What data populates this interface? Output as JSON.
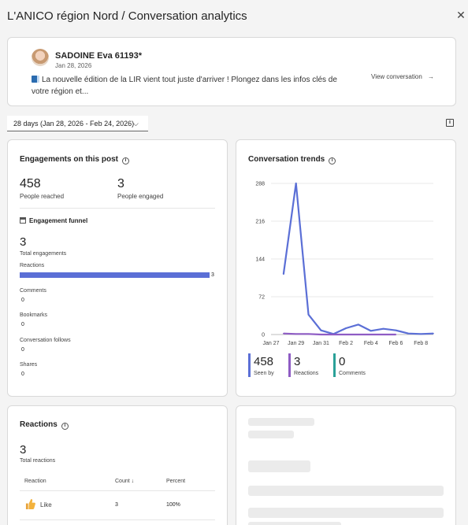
{
  "header": {
    "title": "L'ANICO région Nord / Conversation analytics",
    "close_icon": "close-icon"
  },
  "post": {
    "author": "SADOINE Eva 61193*",
    "date": "Jan 28, 2026",
    "text_line1": "La nouvelle édition de la LIR vient tout juste d'arriver ! Plongez dans les infos clés de",
    "text_line2": "votre région et...",
    "view_label": "View conversation",
    "view_arrow": "→"
  },
  "period": {
    "label": "28 days (Jan 28, 2026 - Feb 24, 2026)",
    "chevron": "⌵"
  },
  "engagement": {
    "title": "Engagements on this post",
    "reached_value": "458",
    "reached_label": "People reached",
    "engaged_value": "3",
    "engaged_label": "People engaged",
    "funnel_title": "Engagement funnel",
    "total_value": "3",
    "total_label": "Total engagements",
    "rows": [
      {
        "label": "Reactions",
        "value": "3",
        "fraction": 1.0
      },
      {
        "label": "Comments",
        "value": "0"
      },
      {
        "label": "Bookmarks",
        "value": "0"
      },
      {
        "label": "Conversation follows",
        "value": "0"
      },
      {
        "label": "Shares",
        "value": "0"
      }
    ]
  },
  "trends": {
    "title": "Conversation trends",
    "legend": [
      {
        "value": "458",
        "label": "Seen by",
        "color": "#5b6fd6"
      },
      {
        "value": "3",
        "label": "Reactions",
        "color": "#8e5cc4"
      },
      {
        "value": "0",
        "label": "Comments",
        "color": "#2aa198"
      }
    ]
  },
  "chart_data": {
    "type": "line",
    "y_ticks": [
      "0",
      "72",
      "144",
      "216",
      "288"
    ],
    "ylim": [
      0,
      288
    ],
    "x_tick_labels": [
      "Jan 27",
      "Jan 29",
      "Jan 31",
      "Feb 2",
      "Feb 4",
      "Feb 6",
      "Feb 8"
    ],
    "x_days": [
      0,
      2,
      4,
      6,
      8,
      10,
      12
    ],
    "series": [
      {
        "name": "Seen by",
        "color": "#5b6fd6",
        "x": [
          1,
          2,
          3,
          4,
          5,
          6,
          7,
          8,
          9,
          10,
          11,
          12,
          13
        ],
        "y": [
          115,
          288,
          38,
          8,
          1,
          12,
          19,
          7,
          11,
          8,
          2,
          1,
          2
        ]
      },
      {
        "name": "Reactions",
        "color": "#8e5cc4",
        "x": [
          1,
          2,
          3,
          4,
          5,
          6,
          7,
          8,
          9,
          10
        ],
        "y": [
          2,
          1,
          1,
          0,
          0,
          0,
          0,
          0,
          0,
          0
        ]
      }
    ]
  },
  "reactions": {
    "title": "Reactions",
    "total_value": "3",
    "total_label": "Total reactions",
    "columns": [
      "Reaction",
      "Count",
      "Percent"
    ],
    "count_sort_icon": "↓",
    "rows": [
      {
        "reaction": "Like",
        "count": "3",
        "percent": "100%"
      }
    ]
  }
}
